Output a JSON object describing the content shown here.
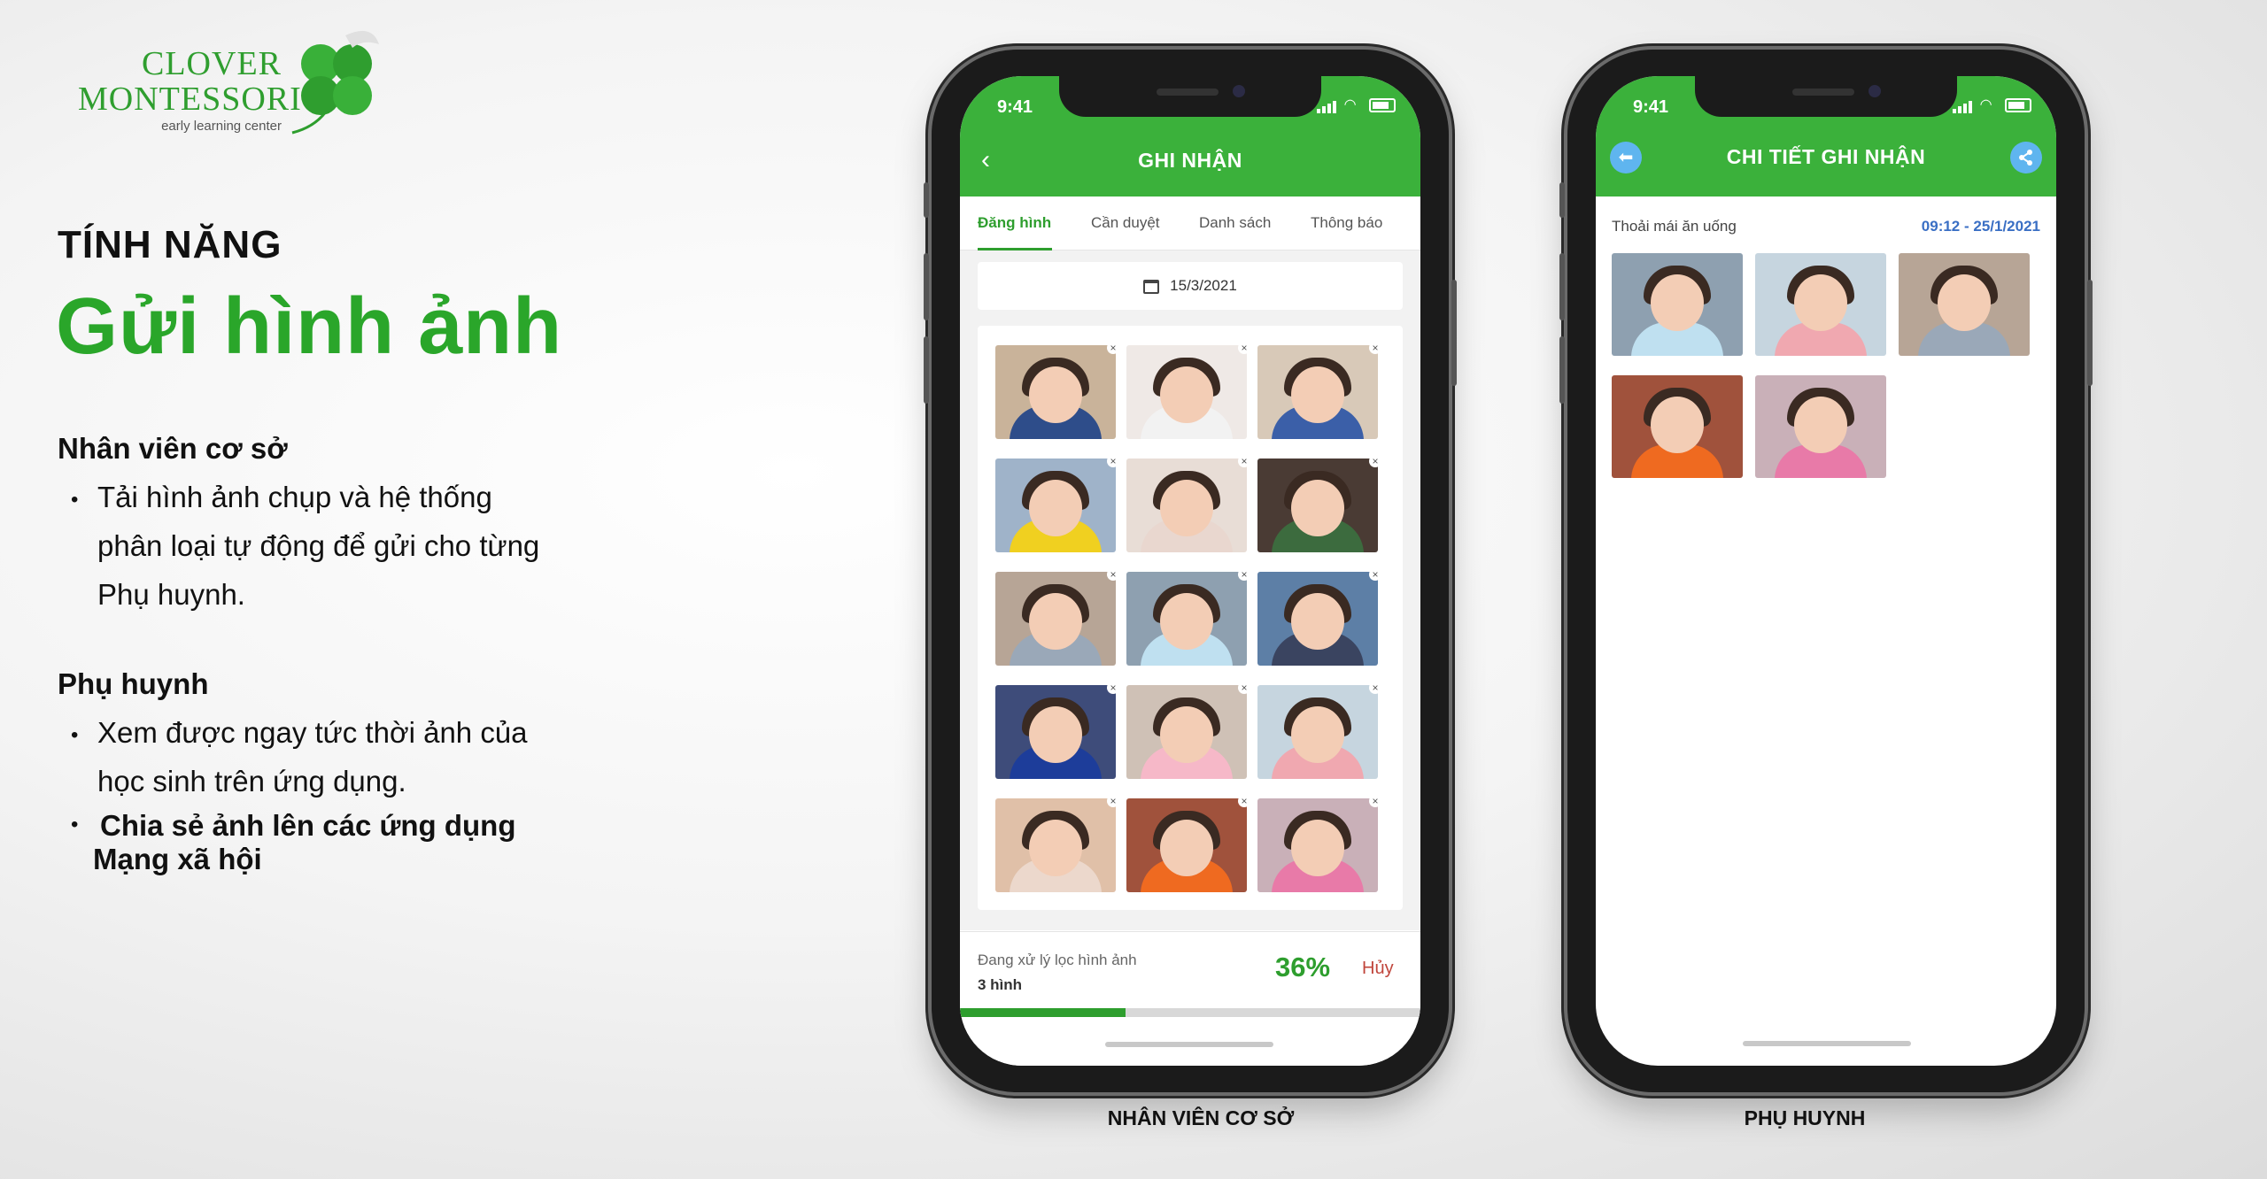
{
  "logo": {
    "line1": "CLOVER",
    "line2": "MONTESSORI",
    "tagline": "early learning center"
  },
  "feature": {
    "kicker": "TÍNH NĂNG",
    "title": "Gửi hình ảnh"
  },
  "staff_section": {
    "heading": "Nhân viên cơ sở",
    "bullets": [
      [
        "Tải hình ảnh chụp và hệ thống",
        "phân loại tự động để gửi cho từng",
        "Phụ huynh."
      ]
    ]
  },
  "parent_section": {
    "heading": "Phụ huynh",
    "bullets": [
      [
        "Xem được ngay tức thời ảnh của",
        "học sinh trên ứng dụng."
      ],
      [
        "Chia sẻ ảnh lên các ứng dụng",
        "Mạng xã hội"
      ]
    ]
  },
  "phone_staff": {
    "caption": "NHÂN VIÊN CƠ SỞ",
    "status_time": "9:41",
    "title": "GHI NHẬN",
    "tabs": [
      "Đăng hình",
      "Cần duyệt",
      "Danh sách",
      "Thông báo"
    ],
    "active_tab": "Đăng hình",
    "date": "15/3/2021",
    "processing_label": "Đang xử lý lọc hình ảnh",
    "processing_count": "3 hình",
    "progress_percent_text": "36%",
    "progress_fraction": 0.36,
    "cancel_label": "Hủy",
    "photo_count": 15
  },
  "phone_parent": {
    "caption": "PHỤ HUYNH",
    "status_time": "9:41",
    "title": "CHI TIẾT GHI NHẬN",
    "record_label": "Thoải mái ăn uống",
    "record_time": "09:12 - 25/1/2021",
    "photo_count": 5
  },
  "colors": {
    "brand_green": "#3bb13b",
    "accent_green": "#2aa62a",
    "cancel_red": "#c0453b",
    "time_blue": "#3a6fc4",
    "button_blue": "#5fb5ef"
  },
  "icons": [
    "clover-logo-icon",
    "back-chevron-icon",
    "calendar-icon",
    "close-icon",
    "back-arrow-icon",
    "share-icon",
    "signal-icon",
    "wifi-icon",
    "battery-icon"
  ]
}
